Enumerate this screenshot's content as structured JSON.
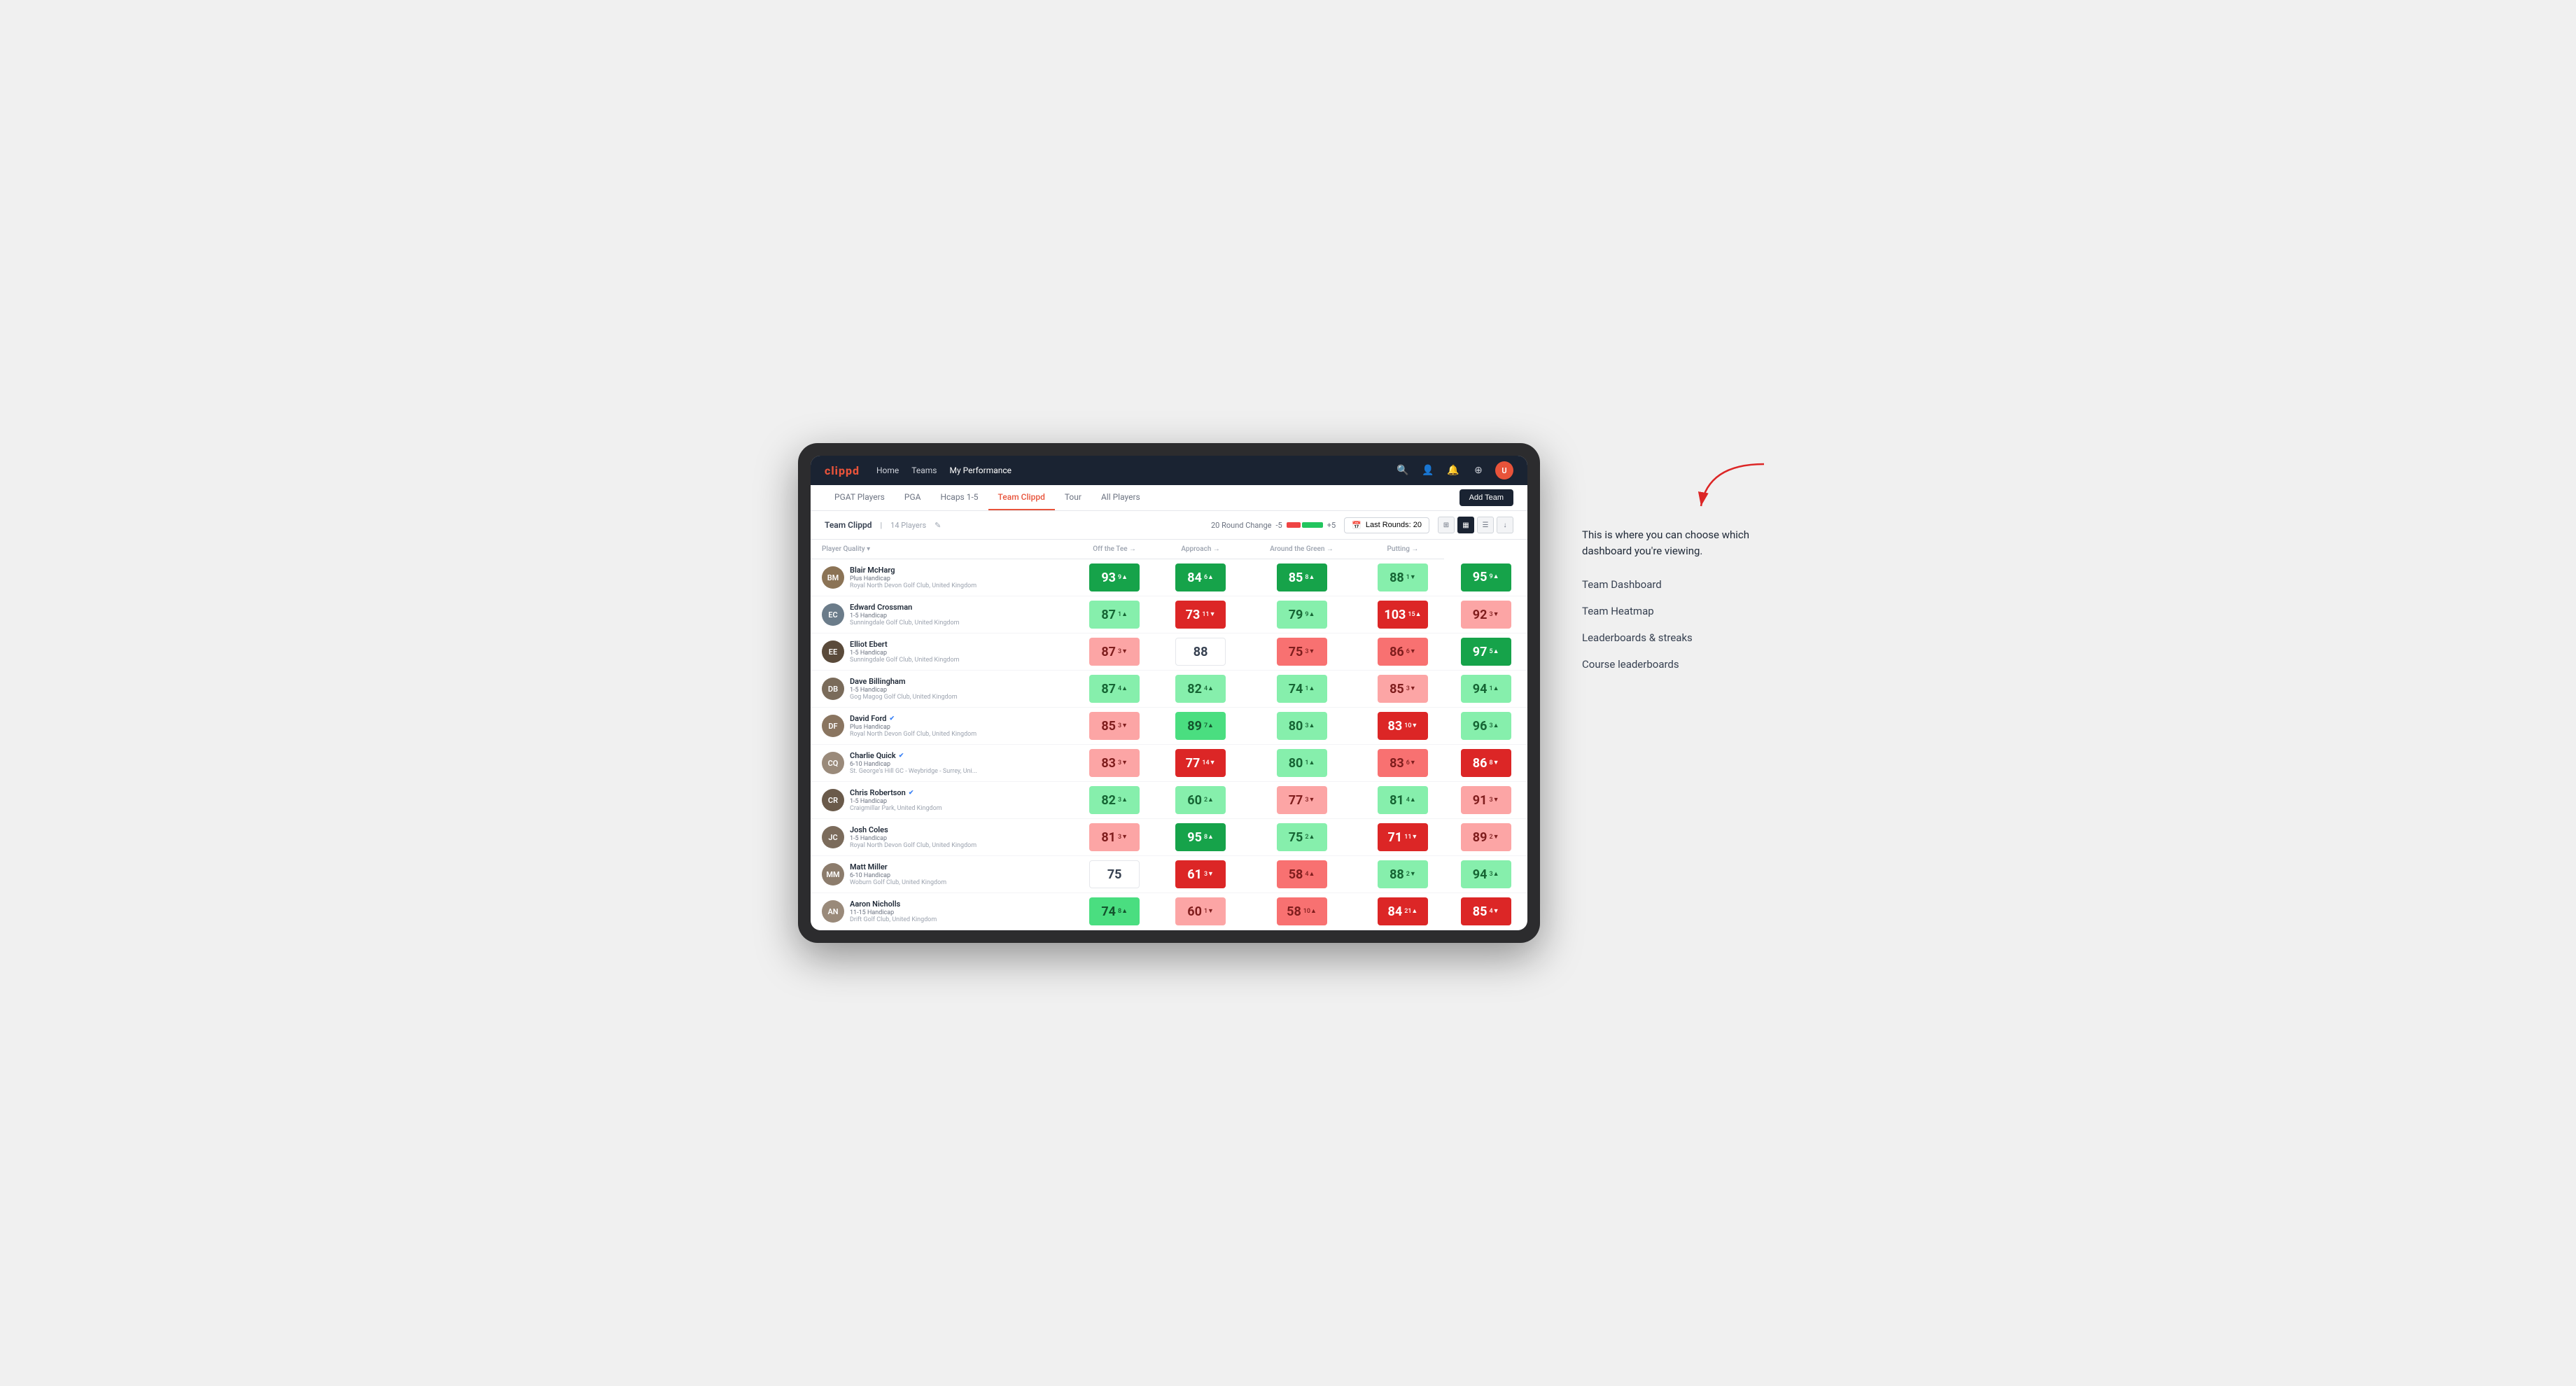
{
  "nav": {
    "logo": "clippd",
    "links": [
      "Home",
      "Teams",
      "My Performance"
    ],
    "icons": [
      "search",
      "person",
      "bell",
      "settings",
      "avatar"
    ]
  },
  "sub_nav": {
    "items": [
      "PGAT Players",
      "PGA",
      "Hcaps 1-5",
      "Team Clippd",
      "Tour",
      "All Players"
    ],
    "active": "Team Clippd",
    "add_team_label": "Add Team"
  },
  "team_header": {
    "title": "Team Clippd",
    "separator": "|",
    "count": "14 Players",
    "round_change_label": "20 Round Change",
    "change_neg": "-5",
    "change_pos": "+5",
    "last_rounds_label": "Last Rounds:",
    "last_rounds_value": "20"
  },
  "table": {
    "columns": [
      "Player Quality ▾",
      "Off the Tee →",
      "Approach →",
      "Around the Green →",
      "Putting →"
    ],
    "rows": [
      {
        "name": "Blair McHarg",
        "handicap": "Plus Handicap",
        "club": "Royal North Devon Golf Club, United Kingdom",
        "avatar_initials": "BM",
        "avatar_color": "#8b7355",
        "scores": [
          {
            "value": "93",
            "change": "9▲",
            "bg": "bg-green-dark"
          },
          {
            "value": "84",
            "change": "6▲",
            "bg": "bg-green-dark"
          },
          {
            "value": "85",
            "change": "8▲",
            "bg": "bg-green-dark"
          },
          {
            "value": "88",
            "change": "1▼",
            "bg": "bg-green-light"
          },
          {
            "value": "95",
            "change": "9▲",
            "bg": "bg-green-dark"
          }
        ]
      },
      {
        "name": "Edward Crossman",
        "handicap": "1-5 Handicap",
        "club": "Sunningdale Golf Club, United Kingdom",
        "avatar_initials": "EC",
        "avatar_color": "#6b7c8a",
        "scores": [
          {
            "value": "87",
            "change": "1▲",
            "bg": "bg-green-light"
          },
          {
            "value": "73",
            "change": "11▼",
            "bg": "bg-red-dark"
          },
          {
            "value": "79",
            "change": "9▲",
            "bg": "bg-green-light"
          },
          {
            "value": "103",
            "change": "15▲",
            "bg": "bg-red-dark"
          },
          {
            "value": "92",
            "change": "3▼",
            "bg": "bg-red-light"
          }
        ]
      },
      {
        "name": "Elliot Ebert",
        "handicap": "1-5 Handicap",
        "club": "Sunningdale Golf Club, United Kingdom",
        "avatar_initials": "EE",
        "avatar_color": "#5a4a3a",
        "scores": [
          {
            "value": "87",
            "change": "3▼",
            "bg": "bg-red-light"
          },
          {
            "value": "88",
            "change": "",
            "bg": "bg-white"
          },
          {
            "value": "75",
            "change": "3▼",
            "bg": "bg-red-mid"
          },
          {
            "value": "86",
            "change": "6▼",
            "bg": "bg-red-mid"
          },
          {
            "value": "97",
            "change": "5▲",
            "bg": "bg-green-dark"
          }
        ]
      },
      {
        "name": "Dave Billingham",
        "handicap": "1-5 Handicap",
        "club": "Gog Magog Golf Club, United Kingdom",
        "avatar_initials": "DB",
        "avatar_color": "#7a6b5a",
        "scores": [
          {
            "value": "87",
            "change": "4▲",
            "bg": "bg-green-light"
          },
          {
            "value": "82",
            "change": "4▲",
            "bg": "bg-green-light"
          },
          {
            "value": "74",
            "change": "1▲",
            "bg": "bg-green-light"
          },
          {
            "value": "85",
            "change": "3▼",
            "bg": "bg-red-light"
          },
          {
            "value": "94",
            "change": "1▲",
            "bg": "bg-green-light"
          }
        ]
      },
      {
        "name": "David Ford",
        "handicap": "Plus Handicap",
        "club": "Royal North Devon Golf Club, United Kingdom",
        "avatar_initials": "DF",
        "avatar_color": "#8a7560",
        "verified": true,
        "scores": [
          {
            "value": "85",
            "change": "3▼",
            "bg": "bg-red-light"
          },
          {
            "value": "89",
            "change": "7▲",
            "bg": "bg-green-mid"
          },
          {
            "value": "80",
            "change": "3▲",
            "bg": "bg-green-light"
          },
          {
            "value": "83",
            "change": "10▼",
            "bg": "bg-red-dark"
          },
          {
            "value": "96",
            "change": "3▲",
            "bg": "bg-green-light"
          }
        ]
      },
      {
        "name": "Charlie Quick",
        "handicap": "6-10 Handicap",
        "club": "St. George's Hill GC - Weybridge - Surrey, Uni...",
        "avatar_initials": "CQ",
        "avatar_color": "#9a8a7a",
        "verified": true,
        "scores": [
          {
            "value": "83",
            "change": "3▼",
            "bg": "bg-red-light"
          },
          {
            "value": "77",
            "change": "14▼",
            "bg": "bg-red-dark"
          },
          {
            "value": "80",
            "change": "1▲",
            "bg": "bg-green-light"
          },
          {
            "value": "83",
            "change": "6▼",
            "bg": "bg-red-mid"
          },
          {
            "value": "86",
            "change": "8▼",
            "bg": "bg-red-dark"
          }
        ]
      },
      {
        "name": "Chris Robertson",
        "handicap": "1-5 Handicap",
        "club": "Craigmillar Park, United Kingdom",
        "avatar_initials": "CR",
        "avatar_color": "#6a5a4a",
        "verified": true,
        "scores": [
          {
            "value": "82",
            "change": "3▲",
            "bg": "bg-green-light"
          },
          {
            "value": "60",
            "change": "2▲",
            "bg": "bg-green-light"
          },
          {
            "value": "77",
            "change": "3▼",
            "bg": "bg-red-light"
          },
          {
            "value": "81",
            "change": "4▲",
            "bg": "bg-green-light"
          },
          {
            "value": "91",
            "change": "3▼",
            "bg": "bg-red-light"
          }
        ]
      },
      {
        "name": "Josh Coles",
        "handicap": "1-5 Handicap",
        "club": "Royal North Devon Golf Club, United Kingdom",
        "avatar_initials": "JC",
        "avatar_color": "#7b6b5b",
        "scores": [
          {
            "value": "81",
            "change": "3▼",
            "bg": "bg-red-light"
          },
          {
            "value": "95",
            "change": "8▲",
            "bg": "bg-green-dark"
          },
          {
            "value": "75",
            "change": "2▲",
            "bg": "bg-green-light"
          },
          {
            "value": "71",
            "change": "11▼",
            "bg": "bg-red-dark"
          },
          {
            "value": "89",
            "change": "2▼",
            "bg": "bg-red-light"
          }
        ]
      },
      {
        "name": "Matt Miller",
        "handicap": "6-10 Handicap",
        "club": "Woburn Golf Club, United Kingdom",
        "avatar_initials": "MM",
        "avatar_color": "#8c7c6c",
        "scores": [
          {
            "value": "75",
            "change": "",
            "bg": "bg-white"
          },
          {
            "value": "61",
            "change": "3▼",
            "bg": "bg-red-dark"
          },
          {
            "value": "58",
            "change": "4▲",
            "bg": "bg-red-mid"
          },
          {
            "value": "88",
            "change": "2▼",
            "bg": "bg-green-light"
          },
          {
            "value": "94",
            "change": "3▲",
            "bg": "bg-green-light"
          }
        ]
      },
      {
        "name": "Aaron Nicholls",
        "handicap": "11-15 Handicap",
        "club": "Drift Golf Club, United Kingdom",
        "avatar_initials": "AN",
        "avatar_color": "#9a8a7a",
        "scores": [
          {
            "value": "74",
            "change": "8▲",
            "bg": "bg-green-mid"
          },
          {
            "value": "60",
            "change": "1▼",
            "bg": "bg-red-light"
          },
          {
            "value": "58",
            "change": "10▲",
            "bg": "bg-red-mid"
          },
          {
            "value": "84",
            "change": "21▲",
            "bg": "bg-red-dark"
          },
          {
            "value": "85",
            "change": "4▼",
            "bg": "bg-red-dark"
          }
        ]
      }
    ]
  },
  "annotation": {
    "intro": "This is where you can choose which dashboard you're viewing.",
    "items": [
      "Team Dashboard",
      "Team Heatmap",
      "Leaderboards & streaks",
      "Course leaderboards"
    ]
  }
}
